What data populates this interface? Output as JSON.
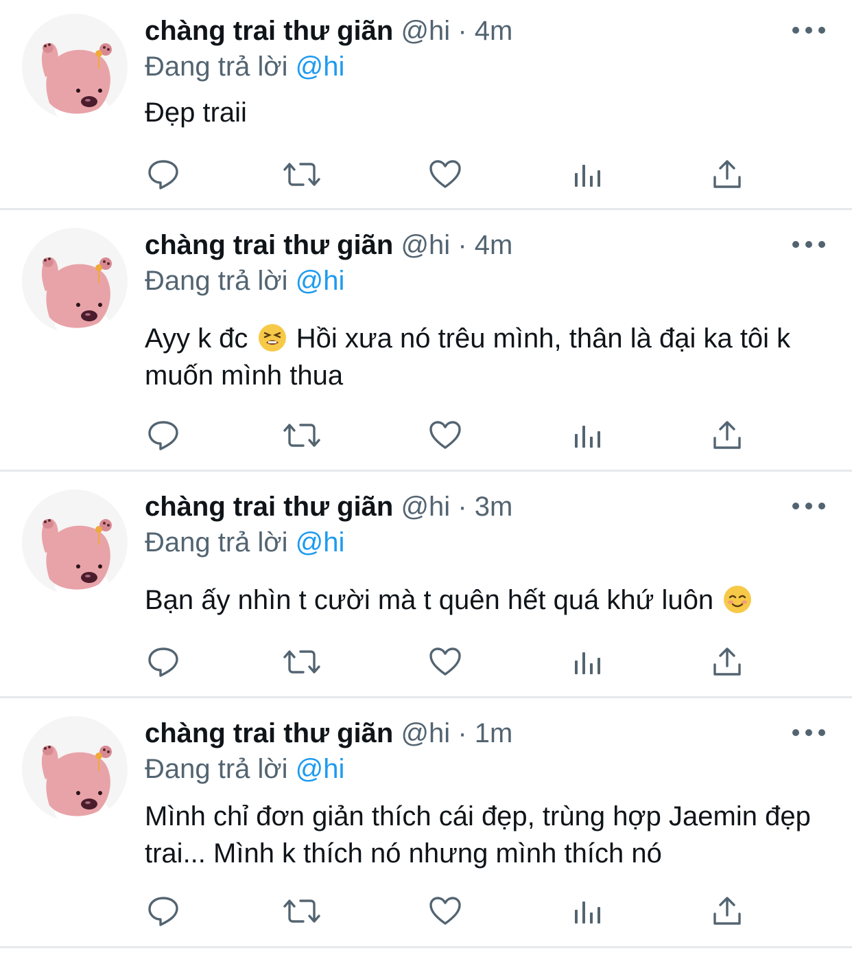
{
  "tweets": [
    {
      "name": "chàng trai thư giãn",
      "handle": "@hi",
      "separator": "·",
      "time": "4m",
      "reply_prefix": "Đang trả lời",
      "reply_to": "@hi",
      "text": "Đẹp traii"
    },
    {
      "name": "chàng trai thư giãn",
      "handle": "@hi",
      "separator": "·",
      "time": "4m",
      "reply_prefix": "Đang trả lời",
      "reply_to": "@hi",
      "text_before_emoji": "Ayy k đc",
      "emoji": "😫",
      "text_after_emoji": " Hồi xưa nó trêu mình, thân là đại ka tôi k muốn mình thua"
    },
    {
      "name": "chàng trai thư giãn",
      "handle": "@hi",
      "separator": "·",
      "time": "3m",
      "reply_prefix": "Đang trả lời",
      "reply_to": "@hi",
      "text_before_emoji": "Bạn ấy nhìn t cười mà t quên hết quá khứ luôn",
      "emoji": "☺️"
    },
    {
      "name": "chàng trai thư giãn",
      "handle": "@hi",
      "separator": "·",
      "time": "1m",
      "reply_prefix": "Đang trả lời",
      "reply_to": "@hi",
      "text": "Mình chỉ đơn giản thích cái đẹp, trùng hợp Jaemin đẹp trai... Mình k thích nó nhưng mình thích nó"
    }
  ],
  "icons": {
    "more": "more-horizontal-icon",
    "reply": "reply-bubble-icon",
    "retweet": "retweet-icon",
    "like": "heart-icon",
    "views": "bar-chart-icon",
    "share": "share-upload-icon"
  },
  "colors": {
    "text": "#0f1419",
    "secondary": "#536471",
    "mention": "#1d9bf0",
    "divider": "#e6e9eb",
    "avatar_pink": "#e8a3a8"
  }
}
